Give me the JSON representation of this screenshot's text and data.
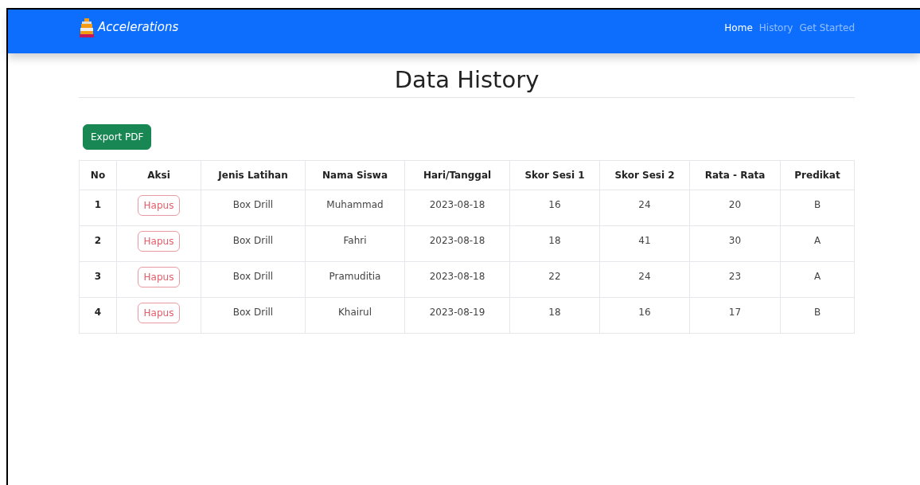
{
  "navbar": {
    "brand": "Accelerations",
    "links": [
      {
        "label": "Home",
        "selected": true
      },
      {
        "label": "History",
        "selected": false
      },
      {
        "label": "Get Started",
        "selected": false
      }
    ]
  },
  "page_title": "Data History",
  "export_button": "Export PDF",
  "table": {
    "columns": [
      "No",
      "Aksi",
      "Jenis Latihan",
      "Nama Siswa",
      "Hari/Tanggal",
      "Skor Sesi 1",
      "Skor Sesi 2",
      "Rata - Rata",
      "Predikat"
    ],
    "rows": [
      {
        "cells": [
          "1",
          "Hapus",
          "Box Drill",
          "Muhammad",
          "2023-08-18",
          "16",
          "24",
          "20",
          "B"
        ]
      },
      {
        "cells": [
          "2",
          "Hapus",
          "Box Drill",
          "Fahri",
          "2023-08-18",
          "18",
          "41",
          "30",
          "A"
        ]
      },
      {
        "cells": [
          "3",
          "Hapus",
          "Box Drill",
          "Pramuditia",
          "2023-08-18",
          "22",
          "24",
          "23",
          "A"
        ]
      },
      {
        "cells": [
          "4",
          "Hapus",
          "Box Drill",
          "Khairul",
          "2023-08-19",
          "18",
          "16",
          "17",
          "B"
        ]
      }
    ]
  }
}
